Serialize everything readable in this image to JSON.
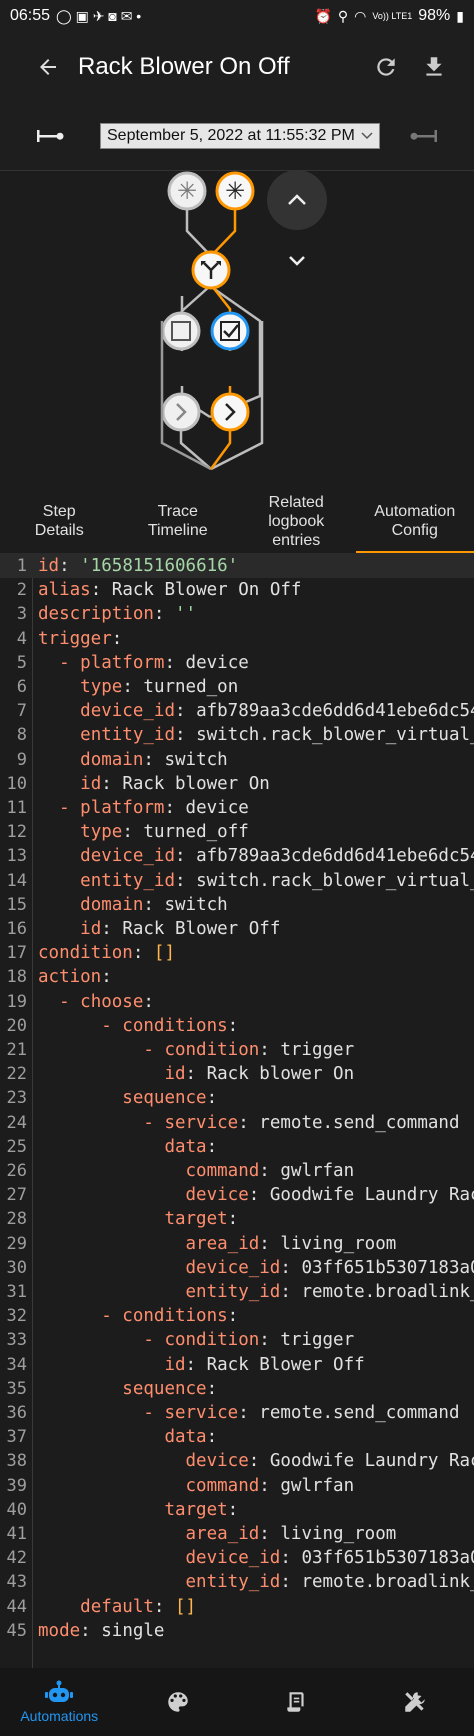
{
  "status": {
    "time": "06:55",
    "battery": "98%",
    "network": "Vo)) LTE1"
  },
  "header": {
    "title": "Rack Blower On Off"
  },
  "trace": {
    "date": "September 5, 2022 at 11:55:32 PM"
  },
  "tabs": [
    {
      "label_line1": "Step",
      "label_line2": "Details"
    },
    {
      "label_line1": "Trace",
      "label_line2": "Timeline"
    },
    {
      "label_line1": "Related",
      "label_line2": "logbook",
      "label_line3": "entries"
    },
    {
      "label_line1": "Automation",
      "label_line2": "Config"
    }
  ],
  "code_lines": [
    {
      "n": "1",
      "ind": "",
      "k": "id",
      "v": "'1658151606616'",
      "vt": "s"
    },
    {
      "n": "2",
      "ind": "",
      "k": "alias",
      "v": "Rack Blower On Off"
    },
    {
      "n": "3",
      "ind": "",
      "k": "description",
      "v": "''",
      "vt": "s"
    },
    {
      "n": "4",
      "ind": "",
      "k": "trigger",
      "v": ""
    },
    {
      "n": "5",
      "ind": "  - ",
      "k": "platform",
      "v": "device"
    },
    {
      "n": "6",
      "ind": "    ",
      "k": "type",
      "v": "turned_on"
    },
    {
      "n": "7",
      "ind": "    ",
      "k": "device_id",
      "v": "afb789aa3cde6dd6d41ebe6dc54"
    },
    {
      "n": "8",
      "ind": "    ",
      "k": "entity_id",
      "v": "switch.rack_blower_virtual_"
    },
    {
      "n": "9",
      "ind": "    ",
      "k": "domain",
      "v": "switch"
    },
    {
      "n": "10",
      "ind": "    ",
      "k": "id",
      "v": "Rack blower On"
    },
    {
      "n": "11",
      "ind": "  - ",
      "k": "platform",
      "v": "device"
    },
    {
      "n": "12",
      "ind": "    ",
      "k": "type",
      "v": "turned_off"
    },
    {
      "n": "13",
      "ind": "    ",
      "k": "device_id",
      "v": "afb789aa3cde6dd6d41ebe6dc54"
    },
    {
      "n": "14",
      "ind": "    ",
      "k": "entity_id",
      "v": "switch.rack_blower_virtual_"
    },
    {
      "n": "15",
      "ind": "    ",
      "k": "domain",
      "v": "switch"
    },
    {
      "n": "16",
      "ind": "    ",
      "k": "id",
      "v": "Rack Blower Off"
    },
    {
      "n": "17",
      "ind": "",
      "k": "condition",
      "v": "[]",
      "vt": "b"
    },
    {
      "n": "18",
      "ind": "",
      "k": "action",
      "v": ""
    },
    {
      "n": "19",
      "ind": "  - ",
      "k": "choose",
      "v": ""
    },
    {
      "n": "20",
      "ind": "      - ",
      "k": "conditions",
      "v": ""
    },
    {
      "n": "21",
      "ind": "          - ",
      "k": "condition",
      "v": "trigger"
    },
    {
      "n": "22",
      "ind": "            ",
      "k": "id",
      "v": "Rack blower On"
    },
    {
      "n": "23",
      "ind": "        ",
      "k": "sequence",
      "v": ""
    },
    {
      "n": "24",
      "ind": "          - ",
      "k": "service",
      "v": "remote.send_command"
    },
    {
      "n": "25",
      "ind": "            ",
      "k": "data",
      "v": ""
    },
    {
      "n": "26",
      "ind": "              ",
      "k": "command",
      "v": "gwlrfan"
    },
    {
      "n": "27",
      "ind": "              ",
      "k": "device",
      "v": "Goodwife Laundry Rac"
    },
    {
      "n": "28",
      "ind": "            ",
      "k": "target",
      "v": ""
    },
    {
      "n": "29",
      "ind": "              ",
      "k": "area_id",
      "v": "living_room"
    },
    {
      "n": "30",
      "ind": "              ",
      "k": "device_id",
      "v": "03ff651b5307183a0"
    },
    {
      "n": "31",
      "ind": "              ",
      "k": "entity_id",
      "v": "remote.broadlink_"
    },
    {
      "n": "32",
      "ind": "      - ",
      "k": "conditions",
      "v": ""
    },
    {
      "n": "33",
      "ind": "          - ",
      "k": "condition",
      "v": "trigger"
    },
    {
      "n": "34",
      "ind": "            ",
      "k": "id",
      "v": "Rack Blower Off"
    },
    {
      "n": "35",
      "ind": "        ",
      "k": "sequence",
      "v": ""
    },
    {
      "n": "36",
      "ind": "          - ",
      "k": "service",
      "v": "remote.send_command"
    },
    {
      "n": "37",
      "ind": "            ",
      "k": "data",
      "v": ""
    },
    {
      "n": "38",
      "ind": "              ",
      "k": "device",
      "v": "Goodwife Laundry Rac"
    },
    {
      "n": "39",
      "ind": "              ",
      "k": "command",
      "v": "gwlrfan"
    },
    {
      "n": "40",
      "ind": "            ",
      "k": "target",
      "v": ""
    },
    {
      "n": "41",
      "ind": "              ",
      "k": "area_id",
      "v": "living_room"
    },
    {
      "n": "42",
      "ind": "              ",
      "k": "device_id",
      "v": "03ff651b5307183a0"
    },
    {
      "n": "43",
      "ind": "              ",
      "k": "entity_id",
      "v": "remote.broadlink_"
    },
    {
      "n": "44",
      "ind": "    ",
      "k": "default",
      "v": "[]",
      "vt": "b"
    },
    {
      "n": "45",
      "ind": "",
      "k": "mode",
      "v": "single"
    }
  ],
  "bottom_nav": {
    "automations_label": "Automations"
  },
  "colors": {
    "accent": "#ff9800",
    "active_blue": "#2196f3",
    "key": "#ff8e6e",
    "string": "#a5d6a7"
  }
}
